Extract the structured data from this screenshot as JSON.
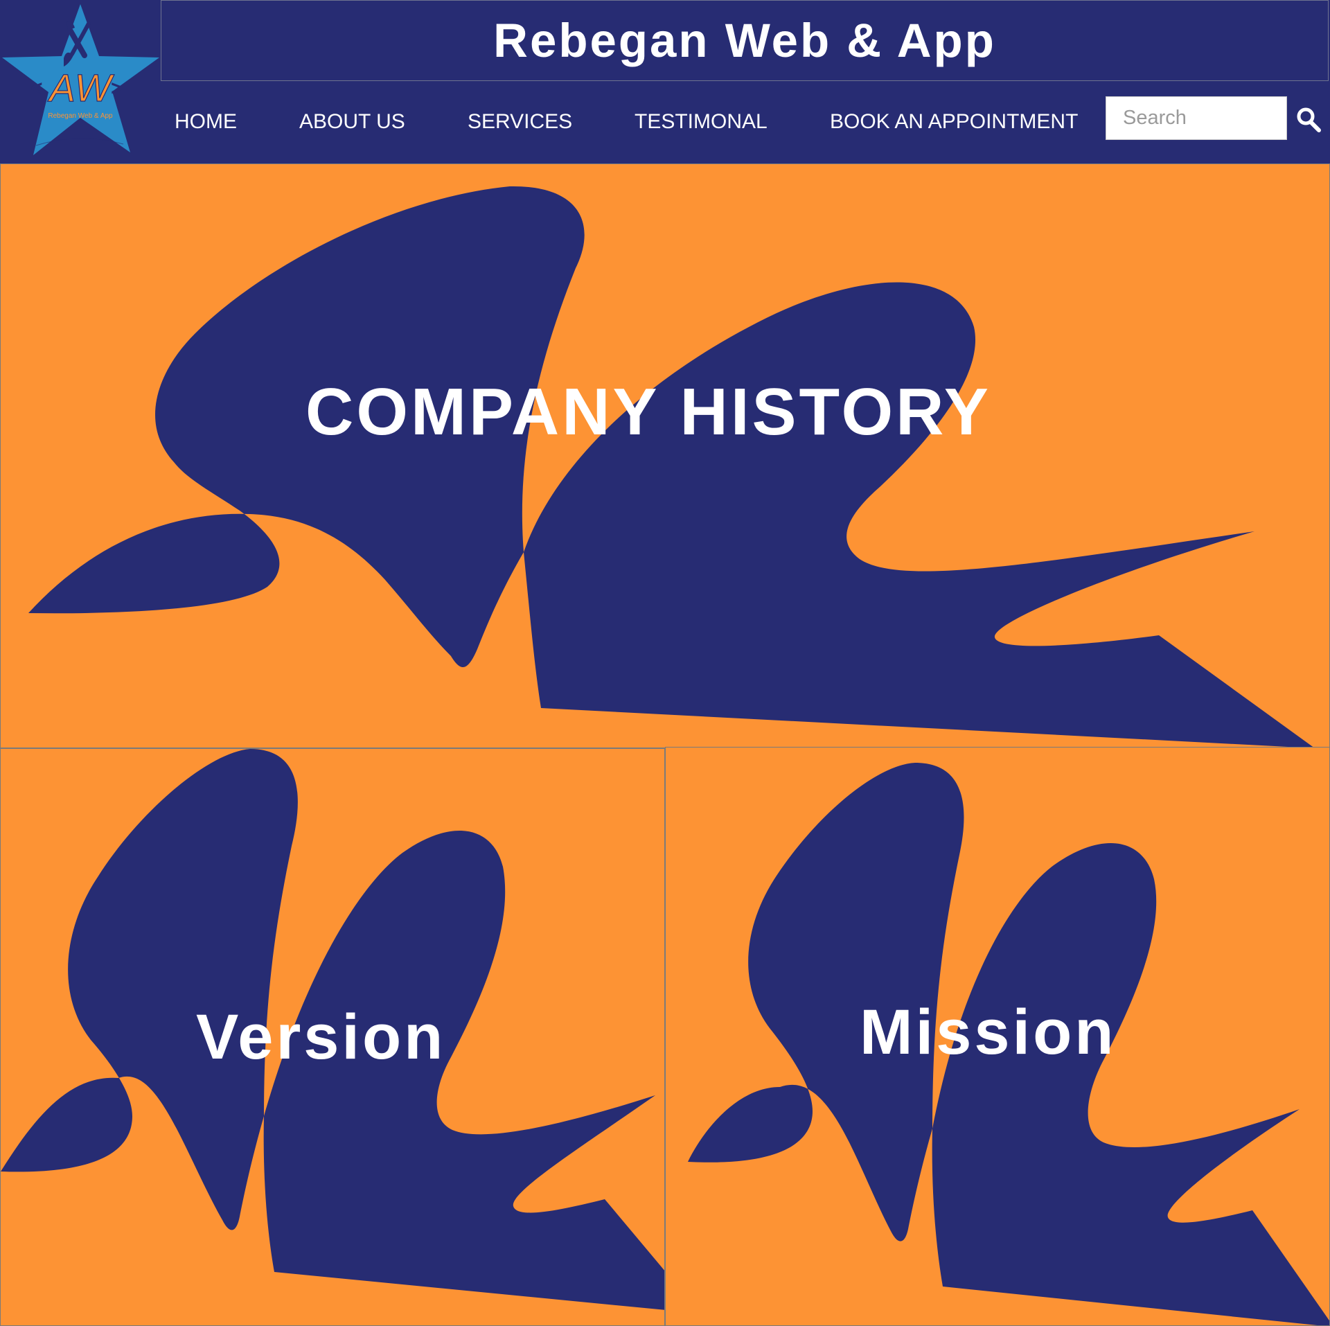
{
  "header": {
    "site_title": "Rebegan Web & App",
    "logo": {
      "initials": "AW",
      "tagline": "Rebegan Web & App",
      "icon": "star-logo-icon"
    }
  },
  "nav": {
    "items": [
      {
        "label": "HOME"
      },
      {
        "label": "ABOUT US"
      },
      {
        "label": "SERVICES"
      },
      {
        "label": "TESTIMONAL"
      },
      {
        "label": "BOOK AN APPOINTMENT"
      }
    ],
    "search": {
      "placeholder": "Search",
      "value": "",
      "icon": "search-icon"
    }
  },
  "sections": {
    "history": {
      "title": "COMPANY HISTORY"
    },
    "version": {
      "title": "Version"
    },
    "mission": {
      "title": "Mission"
    }
  },
  "colors": {
    "navy": "#272c73",
    "orange": "#fd9334",
    "logo_blue": "#2a8bc8",
    "white": "#ffffff"
  }
}
